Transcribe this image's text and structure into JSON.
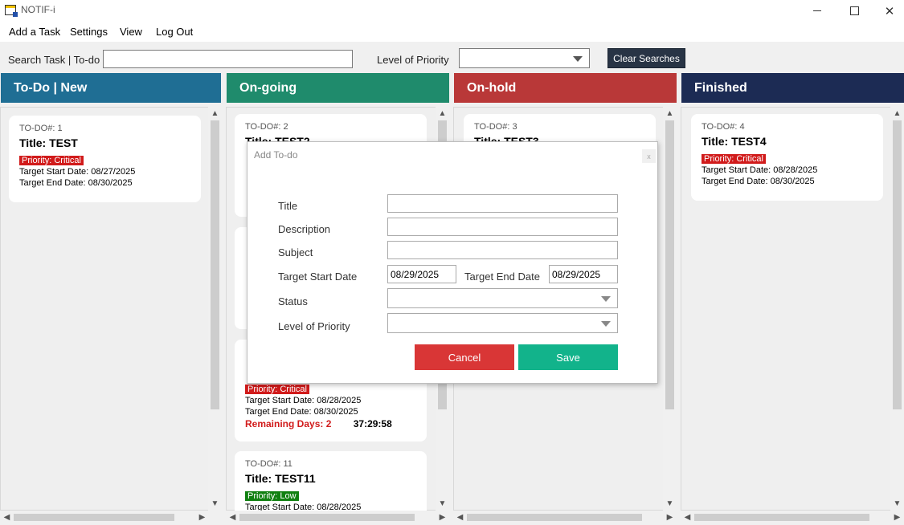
{
  "window": {
    "title": "NOTIF-i"
  },
  "menu": {
    "add_task": "Add a Task",
    "settings": "Settings",
    "view": "View",
    "logout": "Log Out"
  },
  "search": {
    "label": "Search Task | To-do",
    "value": "",
    "priority_label": "Level of Priority",
    "priority_value": "",
    "clear_label": "Clear Searches"
  },
  "columns": [
    {
      "title": "To-Do | New",
      "color": "#1f6e94"
    },
    {
      "title": "On-going",
      "color": "#1f8b6c"
    },
    {
      "title": "On-hold",
      "color": "#b93838"
    },
    {
      "title": "Finished",
      "color": "#1c2b54"
    }
  ],
  "cards": {
    "todo1": {
      "num": "TO-DO#: 1",
      "title": "Title: TEST",
      "priority": "Priority: Critical",
      "start": "Target Start Date: 08/27/2025",
      "end": "Target End Date: 08/30/2025"
    },
    "todo2": {
      "num": "TO-DO#: 2",
      "title": "Title: TEST2"
    },
    "todo3": {
      "num": "TO-DO#: 3",
      "title": "Title: TEST3"
    },
    "todo4": {
      "num": "TO-DO#: 4",
      "title": "Title: TEST4",
      "priority": "Priority: Critical",
      "start": "Target Start Date: 08/28/2025",
      "end": "Target End Date: 08/30/2025"
    },
    "ongoing_c": {
      "priority": "Priority: Critical",
      "start": "Target Start Date: 08/28/2025",
      "end": "Target End Date: 08/30/2025",
      "remaining": "Remaining Days: 2",
      "timer": "37:29:58"
    },
    "todo11": {
      "num": "TO-DO#: 11",
      "title": "Title: TEST11",
      "priority": "Priority: Low",
      "start": "Target Start Date: 08/28/2025"
    }
  },
  "dialog": {
    "title": "Add To-do",
    "close_label": "x",
    "labels": {
      "title": "Title",
      "description": "Description",
      "subject": "Subject",
      "start_date": "Target Start Date",
      "end_date": "Target End Date",
      "status": "Status",
      "priority": "Level of Priority"
    },
    "values": {
      "start_date": "08/29/2025",
      "end_date": "08/29/2025"
    },
    "cancel_label": "Cancel",
    "save_label": "Save"
  }
}
